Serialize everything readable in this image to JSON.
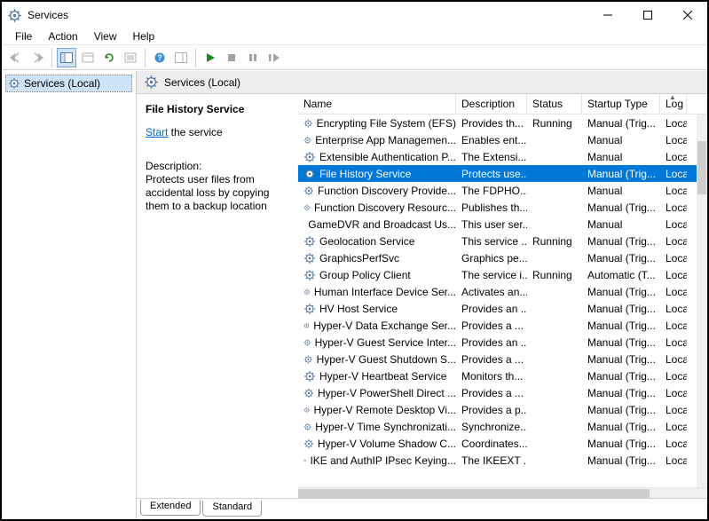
{
  "window": {
    "title": "Services"
  },
  "menu": {
    "file": "File",
    "action": "Action",
    "view": "View",
    "help": "Help"
  },
  "tree": {
    "root": "Services (Local)"
  },
  "header": {
    "title": "Services (Local)"
  },
  "detail": {
    "title": "File History Service",
    "start_label": "Start",
    "start_suffix": " the service",
    "desc_heading": "Description:",
    "desc_body": "Protects user files from accidental loss by copying them to a backup location"
  },
  "columns": {
    "name": "Name",
    "desc": "Description",
    "status": "Status",
    "startup": "Startup Type",
    "logon": "Log On As"
  },
  "rows": [
    {
      "name": "Encrypting File System (EFS)",
      "desc": "Provides th...",
      "status": "Running",
      "startup": "Manual (Trig...",
      "logon": "Loca",
      "selected": false
    },
    {
      "name": "Enterprise App Managemen...",
      "desc": "Enables ent...",
      "status": "",
      "startup": "Manual",
      "logon": "Loca",
      "selected": false
    },
    {
      "name": "Extensible Authentication P...",
      "desc": "The Extensi...",
      "status": "",
      "startup": "Manual",
      "logon": "Loca",
      "selected": false
    },
    {
      "name": "File History Service",
      "desc": "Protects use...",
      "status": "",
      "startup": "Manual (Trig...",
      "logon": "Loca",
      "selected": true
    },
    {
      "name": "Function Discovery Provide...",
      "desc": "The FDPHO...",
      "status": "",
      "startup": "Manual",
      "logon": "Loca",
      "selected": false
    },
    {
      "name": "Function Discovery Resourc...",
      "desc": "Publishes th...",
      "status": "",
      "startup": "Manual (Trig...",
      "logon": "Loca",
      "selected": false
    },
    {
      "name": "GameDVR and Broadcast Us...",
      "desc": "This user ser...",
      "status": "",
      "startup": "Manual",
      "logon": "Loca",
      "selected": false
    },
    {
      "name": "Geolocation Service",
      "desc": "This service ...",
      "status": "Running",
      "startup": "Manual (Trig...",
      "logon": "Loca",
      "selected": false
    },
    {
      "name": "GraphicsPerfSvc",
      "desc": "Graphics pe...",
      "status": "",
      "startup": "Manual (Trig...",
      "logon": "Loca",
      "selected": false
    },
    {
      "name": "Group Policy Client",
      "desc": "The service i...",
      "status": "Running",
      "startup": "Automatic (T...",
      "logon": "Loca",
      "selected": false
    },
    {
      "name": "Human Interface Device Ser...",
      "desc": "Activates an...",
      "status": "",
      "startup": "Manual (Trig...",
      "logon": "Loca",
      "selected": false
    },
    {
      "name": "HV Host Service",
      "desc": "Provides an ...",
      "status": "",
      "startup": "Manual (Trig...",
      "logon": "Loca",
      "selected": false
    },
    {
      "name": "Hyper-V Data Exchange Ser...",
      "desc": "Provides a ...",
      "status": "",
      "startup": "Manual (Trig...",
      "logon": "Loca",
      "selected": false
    },
    {
      "name": "Hyper-V Guest Service Inter...",
      "desc": "Provides an ...",
      "status": "",
      "startup": "Manual (Trig...",
      "logon": "Loca",
      "selected": false
    },
    {
      "name": "Hyper-V Guest Shutdown S...",
      "desc": "Provides a ...",
      "status": "",
      "startup": "Manual (Trig...",
      "logon": "Loca",
      "selected": false
    },
    {
      "name": "Hyper-V Heartbeat Service",
      "desc": "Monitors th...",
      "status": "",
      "startup": "Manual (Trig...",
      "logon": "Loca",
      "selected": false
    },
    {
      "name": "Hyper-V PowerShell Direct ...",
      "desc": "Provides a ...",
      "status": "",
      "startup": "Manual (Trig...",
      "logon": "Loca",
      "selected": false
    },
    {
      "name": "Hyper-V Remote Desktop Vi...",
      "desc": "Provides a p...",
      "status": "",
      "startup": "Manual (Trig...",
      "logon": "Loca",
      "selected": false
    },
    {
      "name": "Hyper-V Time Synchronizati...",
      "desc": "Synchronize...",
      "status": "",
      "startup": "Manual (Trig...",
      "logon": "Loca",
      "selected": false
    },
    {
      "name": "Hyper-V Volume Shadow C...",
      "desc": "Coordinates...",
      "status": "",
      "startup": "Manual (Trig...",
      "logon": "Loca",
      "selected": false
    },
    {
      "name": "IKE and AuthIP IPsec Keying...",
      "desc": "The IKEEXT ...",
      "status": "",
      "startup": "Manual (Trig...",
      "logon": "Loca",
      "selected": false
    }
  ],
  "tabs": {
    "extended": "Extended",
    "standard": "Standard"
  }
}
